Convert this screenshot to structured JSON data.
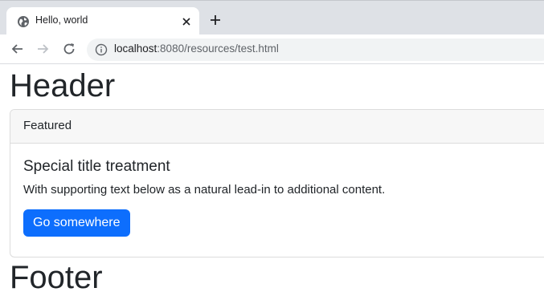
{
  "browser": {
    "tab": {
      "title": "Hello, world"
    },
    "address_bar": {
      "host": "localhost",
      "rest": ":8080/resources/test.html"
    },
    "icons": [
      "globe-icon",
      "close-icon",
      "plus-icon",
      "back-arrow-icon",
      "forward-arrow-icon",
      "reload-icon",
      "info-icon"
    ]
  },
  "page": {
    "header": "Header",
    "card": {
      "header": "Featured",
      "title": "Special title treatment",
      "text": "With supporting text below as a natural lead-in to additional content.",
      "button_label": "Go somewhere"
    },
    "footer": "Footer"
  },
  "colors": {
    "tabstrip": "#dee1e6",
    "button": "#0d6efd",
    "text": "#212529"
  }
}
